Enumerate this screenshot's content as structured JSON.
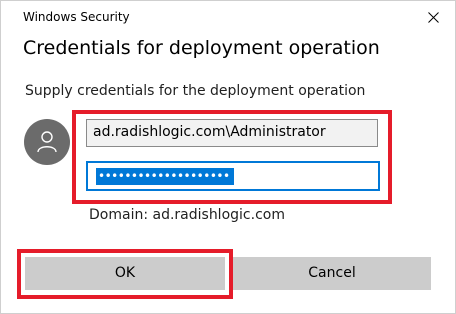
{
  "window": {
    "title": "Windows Security",
    "close_icon": "close-icon"
  },
  "dialog": {
    "heading": "Credentials for deployment operation",
    "message": "Supply credentials for the deployment operation",
    "avatar_icon": "user-icon",
    "username_value": "ad.radishlogic.com\\Administrator",
    "password_masked": "••••••••••••••••••••",
    "password_selected": true,
    "domain_text": "Domain: ad.radishlogic.com"
  },
  "buttons": {
    "ok_label": "OK",
    "cancel_label": "Cancel"
  },
  "colors": {
    "accent": "#0078d7",
    "highlight_box": "#e51c2a",
    "button_bg": "#cccccc",
    "avatar_bg": "#6b6b6b"
  }
}
